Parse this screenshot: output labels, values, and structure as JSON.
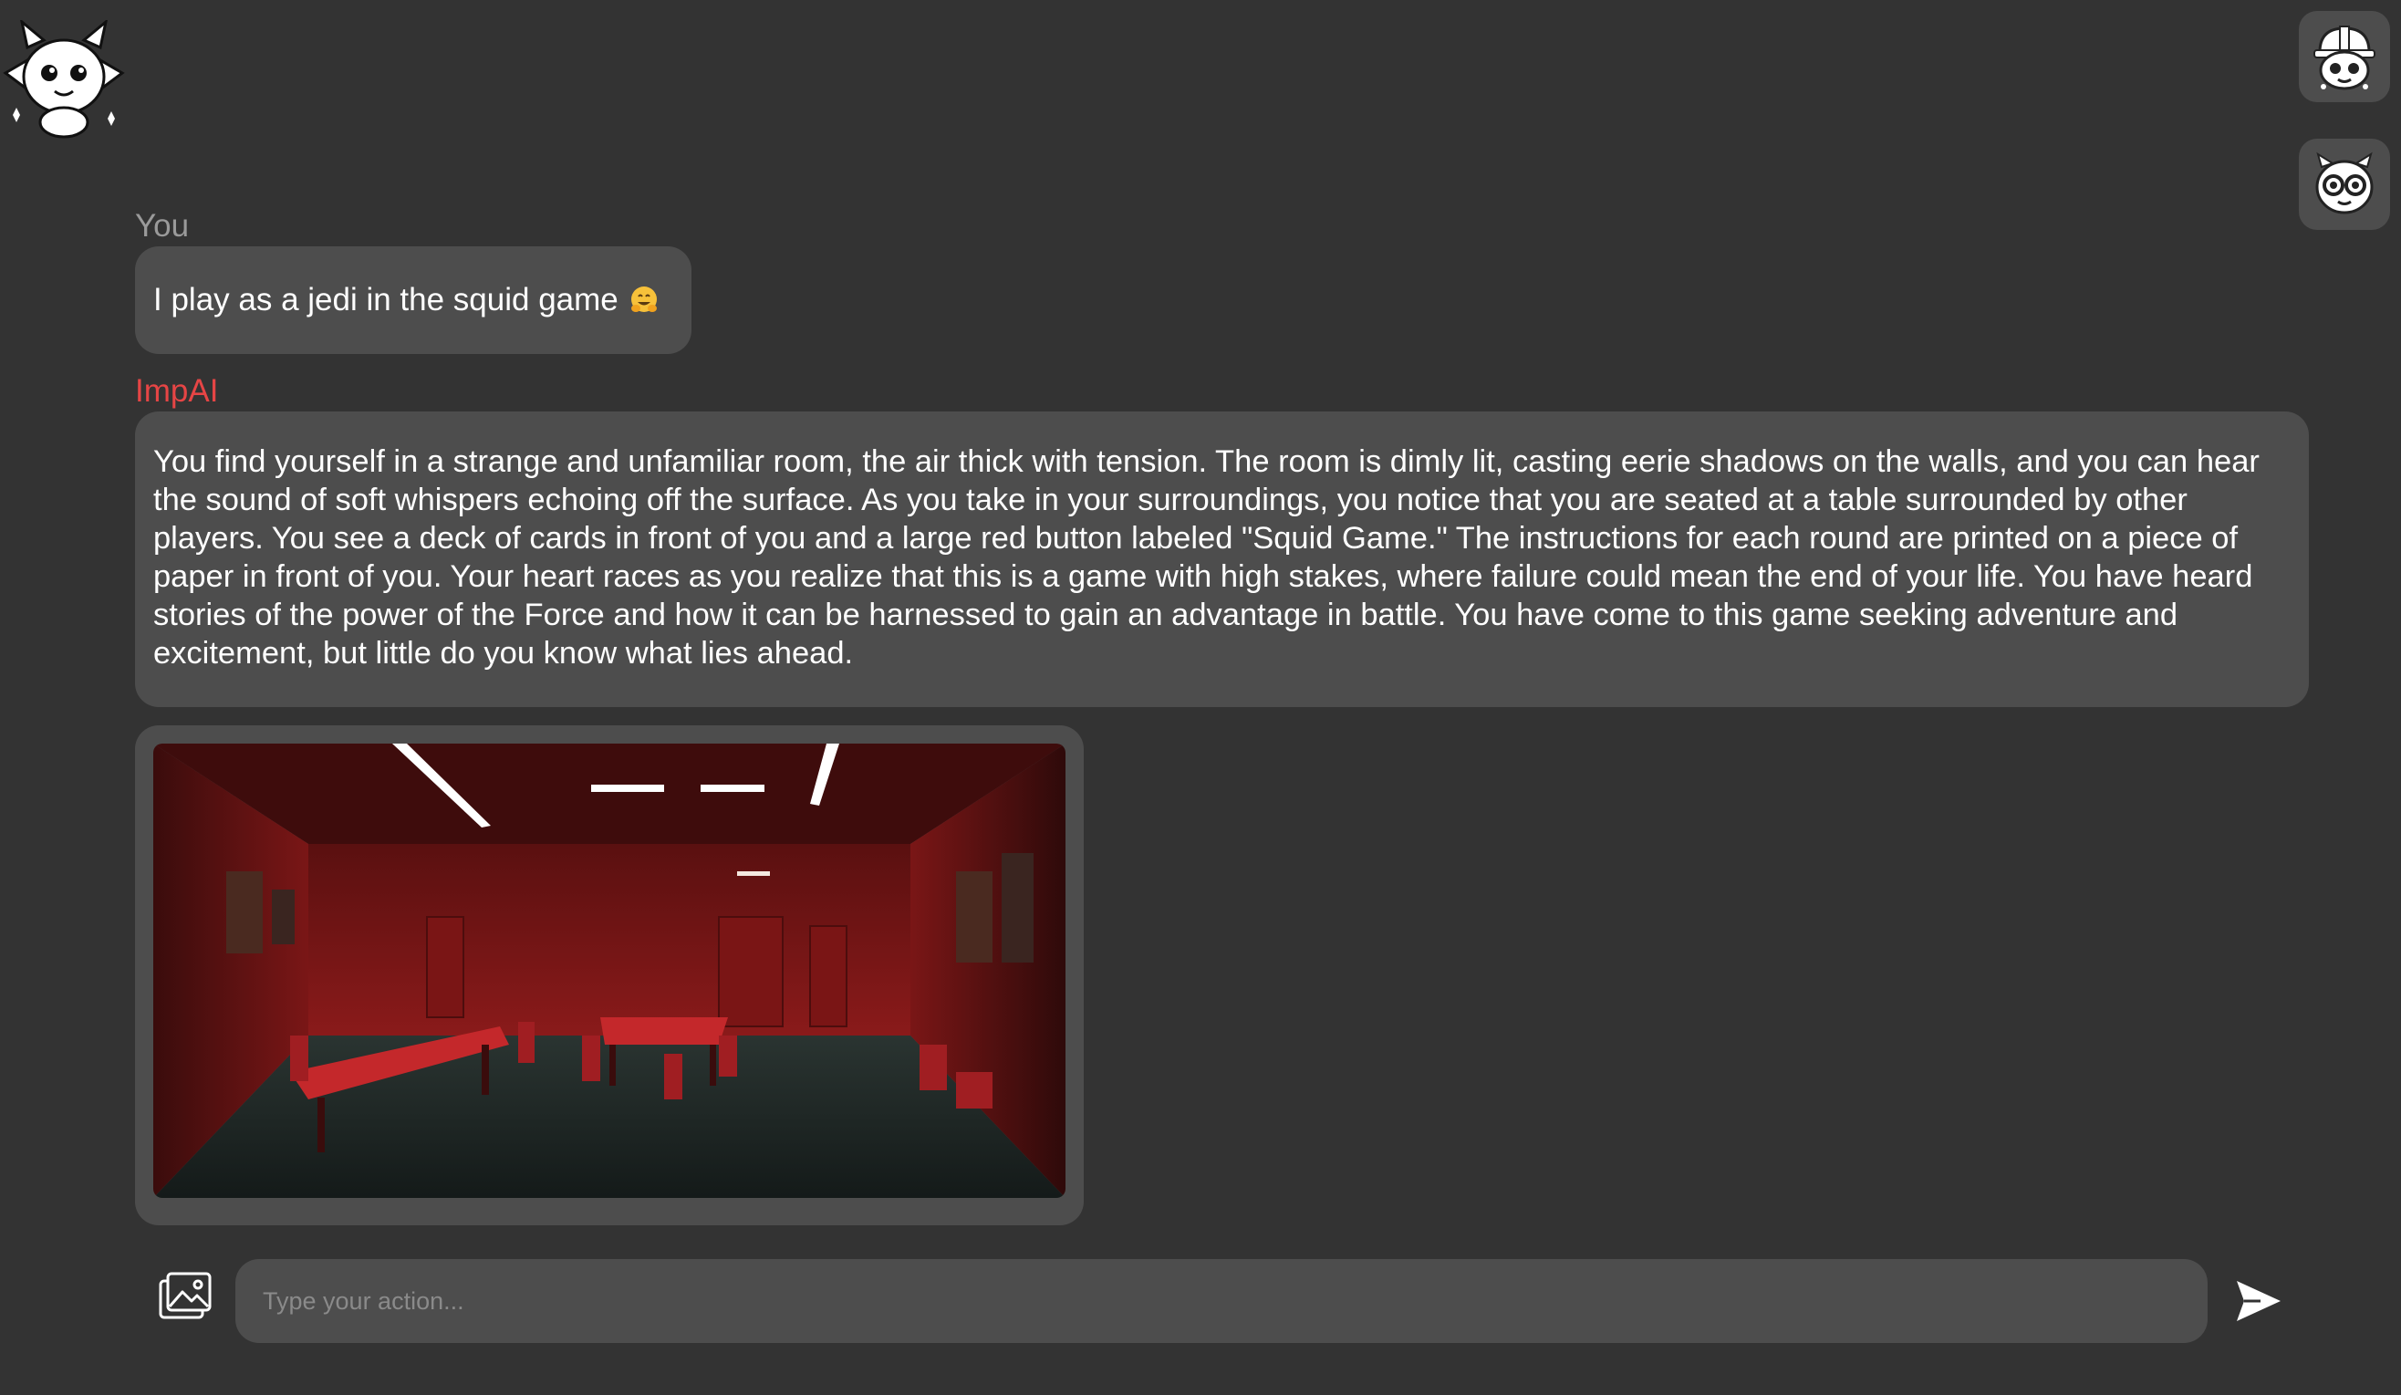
{
  "app": {
    "logo_icon": "imp-mascot-icon"
  },
  "header": {
    "buttons": [
      {
        "icon": "imp-hardhat-avatar-icon"
      },
      {
        "icon": "imp-goggles-avatar-icon"
      }
    ]
  },
  "messages": [
    {
      "sender": "You",
      "text": "I play as a jedi in the squid game",
      "emoji": "hugging-face-emoji"
    },
    {
      "sender": "ImpAI",
      "text": "You find yourself in a strange and unfamiliar room, the air thick with tension. The room is dimly lit, casting eerie shadows on the walls, and you can hear the sound of soft whispers echoing off the surface. As you take in your surroundings, you notice that you are seated at a table surrounded by other players. You see a deck of cards in front of you and a large red button labeled \"Squid Game.\" The instructions for each round are printed on a piece of paper in front of you. Your heart races as you realize that this is a game with high stakes, where failure could mean the end of your life. You have heard stories of the power of the Force and how it can be harnessed to gain an advantage in battle. You have come to this game seeking adventure and excitement, but little do you know what lies ahead.",
      "image_icon": "red-room-scene-image"
    }
  ],
  "composer": {
    "placeholder": "Type your action...",
    "value": "",
    "upload_icon": "image-upload-icon",
    "send_icon": "send-arrow-icon"
  },
  "colors": {
    "background": "#333333",
    "bubble": "#4d4d4d",
    "ai_name": "#e64545",
    "user_name": "#9a9a9a",
    "text": "#ffffff"
  }
}
